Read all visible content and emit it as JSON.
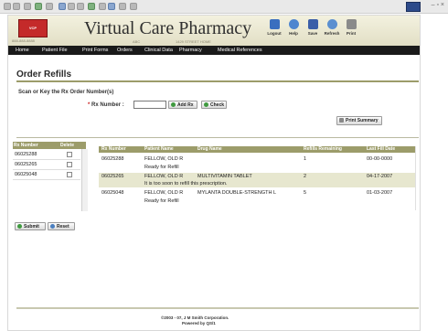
{
  "app": {
    "title": "Virtual Care Pharmacy",
    "logo_text": "VCP",
    "phone": "888-888-8888",
    "subtitle_left": "ABC",
    "subtitle_right": "1429 STREET HOME"
  },
  "toolbar": [
    {
      "label": "Logout",
      "icon": "logout-icon",
      "color": "#3a6fbf"
    },
    {
      "label": "Help",
      "icon": "help-icon",
      "color": "#4f86cf"
    },
    {
      "label": "Save",
      "icon": "save-icon",
      "color": "#3b5ea8"
    },
    {
      "label": "Refresh",
      "icon": "refresh-icon",
      "color": "#5b8fd0"
    },
    {
      "label": "Print",
      "icon": "print-icon",
      "color": "#8a8a8a"
    }
  ],
  "nav": [
    "Home",
    "Patient File",
    "Print Forms",
    "Orders",
    "Clinical Data",
    "Pharmacy",
    "Medical References"
  ],
  "page": {
    "title": "Order Refills",
    "scan_label": "Scan or Key the Rx Order Number(s)",
    "rx_label": "Rx Number :",
    "rx_required": "*",
    "rx_value": "",
    "add_rx_label": "Add Rx",
    "check_label": "Check",
    "print_summary_label": "Print Summary"
  },
  "left_list": {
    "headers": [
      "Rx Number",
      "Delete"
    ],
    "rows": [
      "06025288",
      "06025265",
      "06025048"
    ],
    "submit_label": "Submit",
    "reset_label": "Reset"
  },
  "results": {
    "headers": [
      "Rx Number",
      "Patient Name",
      "Drug Name",
      "Refills Remaining",
      "Last Fill Date"
    ],
    "rows": [
      {
        "rx": "06025288",
        "patient": "FELLOW, OLD R",
        "drug": "",
        "refills": "1",
        "date": "00-00-0000",
        "note": "Ready for Refill"
      },
      {
        "rx": "06025265",
        "patient": "FELLOW, OLD R",
        "drug": "MULTIVITAMIN TABLET",
        "refills": "2",
        "date": "04-17-2007",
        "note": "It is too soon to refill this prescription."
      },
      {
        "rx": "06025048",
        "patient": "FELLOW, OLD R",
        "drug": "MYLANTA DOUBLE-STRENGTH L",
        "refills": "5",
        "date": "01-03-2007",
        "note": "Ready for Refill"
      }
    ]
  },
  "footer": {
    "line1": "©2003 - 07, J M Smith Corporation.",
    "line2": "Powered by QS/1"
  },
  "colors": {
    "accent": "#9c9c6a",
    "nav_bg": "#1a1a1a",
    "row_alt": "#e7e7cf"
  }
}
